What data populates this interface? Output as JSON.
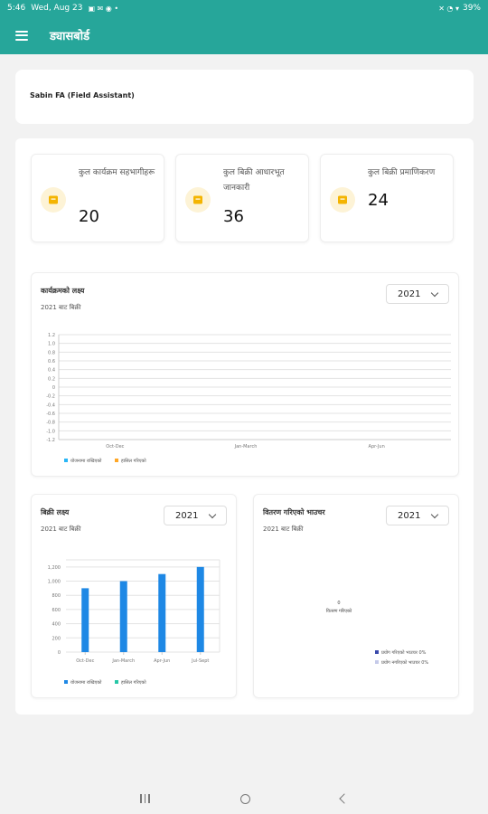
{
  "status_bar": {
    "time": "5:46",
    "date": "Wed, Aug 23",
    "battery": "39%"
  },
  "app_bar": {
    "title": "ड्यासबोर्ड"
  },
  "user": {
    "name": "Sabin FA (Field Assistant)"
  },
  "stats": [
    {
      "label": "कुल कार्यक्रम सहभागीहरू",
      "value": "20",
      "icon": "book-icon"
    },
    {
      "label": "कुल बिक्री आधारभूत जानकारी",
      "value": "36",
      "icon": "book-icon"
    },
    {
      "label": "कुल बिक्री प्रमाणिकरण",
      "value": "24",
      "icon": "book-icon"
    }
  ],
  "colors": {
    "teal": "#26a69a",
    "bar_blue": "#1e88e5",
    "legend_orange": "#ffa726",
    "legend_green": "#26c6a6",
    "pie_dark": "#3949ab",
    "pie_light": "#c5cae9"
  },
  "program_chart": {
    "title": "कार्यक्रमको लक्ष्य",
    "subtitle": "2021 बाट बिक्री",
    "year": "2021",
    "chart_data": {
      "type": "line",
      "categories": [
        "Oct-Dec",
        "Jan-March",
        "Apr-Jun"
      ],
      "series": [
        {
          "name": "योजनामा राखिएको",
          "values": [
            0,
            0,
            0
          ],
          "color": "#29b6f6"
        },
        {
          "name": "हासिल गरिएको",
          "values": [
            0,
            0,
            0
          ],
          "color": "#ffa726"
        }
      ],
      "yticks": [
        "1.2",
        "1.0",
        "0.8",
        "0.6",
        "0.4",
        "0.2",
        "0",
        "-0.2",
        "-0.4",
        "-0.6",
        "-0.8",
        "-1.0",
        "-1.2"
      ],
      "ylim": [
        -1.2,
        1.2
      ],
      "grid": true,
      "legend": "bottom-left"
    }
  },
  "sales_chart": {
    "title": "बिक्री लक्ष्य",
    "subtitle": "2021 बाट बिक्री",
    "year": "2021",
    "chart_data": {
      "type": "bar",
      "categories": [
        "Oct-Dec",
        "Jan-March",
        "Apr-Jun",
        "Jul-Sept"
      ],
      "series": [
        {
          "name": "योजनामा राखिएको",
          "values": [
            900,
            1000,
            1100,
            1200
          ],
          "color": "#1e88e5"
        },
        {
          "name": "हासिल गरिएको",
          "values": [
            0,
            0,
            0,
            0
          ],
          "color": "#26c6a6"
        }
      ],
      "yticks": [
        "1,200",
        "1,000",
        "800",
        "600",
        "400",
        "200",
        "0"
      ],
      "ylim": [
        0,
        1300
      ],
      "grid": true,
      "legend": "bottom-left"
    }
  },
  "distribution_chart": {
    "title": "वितरण गरिएको भाउचर",
    "subtitle": "2021 बाट बिक्री",
    "year": "2021",
    "chart_data": {
      "type": "pie",
      "center_value": "0",
      "center_label": "वितरण गरिएको",
      "legend": [
        {
          "label": "प्रयोग गरिएको भाउचर 0%",
          "color": "#3949ab"
        },
        {
          "label": "प्रयोग नगरिएको भाउचर 0%",
          "color": "#c5cae9"
        }
      ]
    }
  }
}
